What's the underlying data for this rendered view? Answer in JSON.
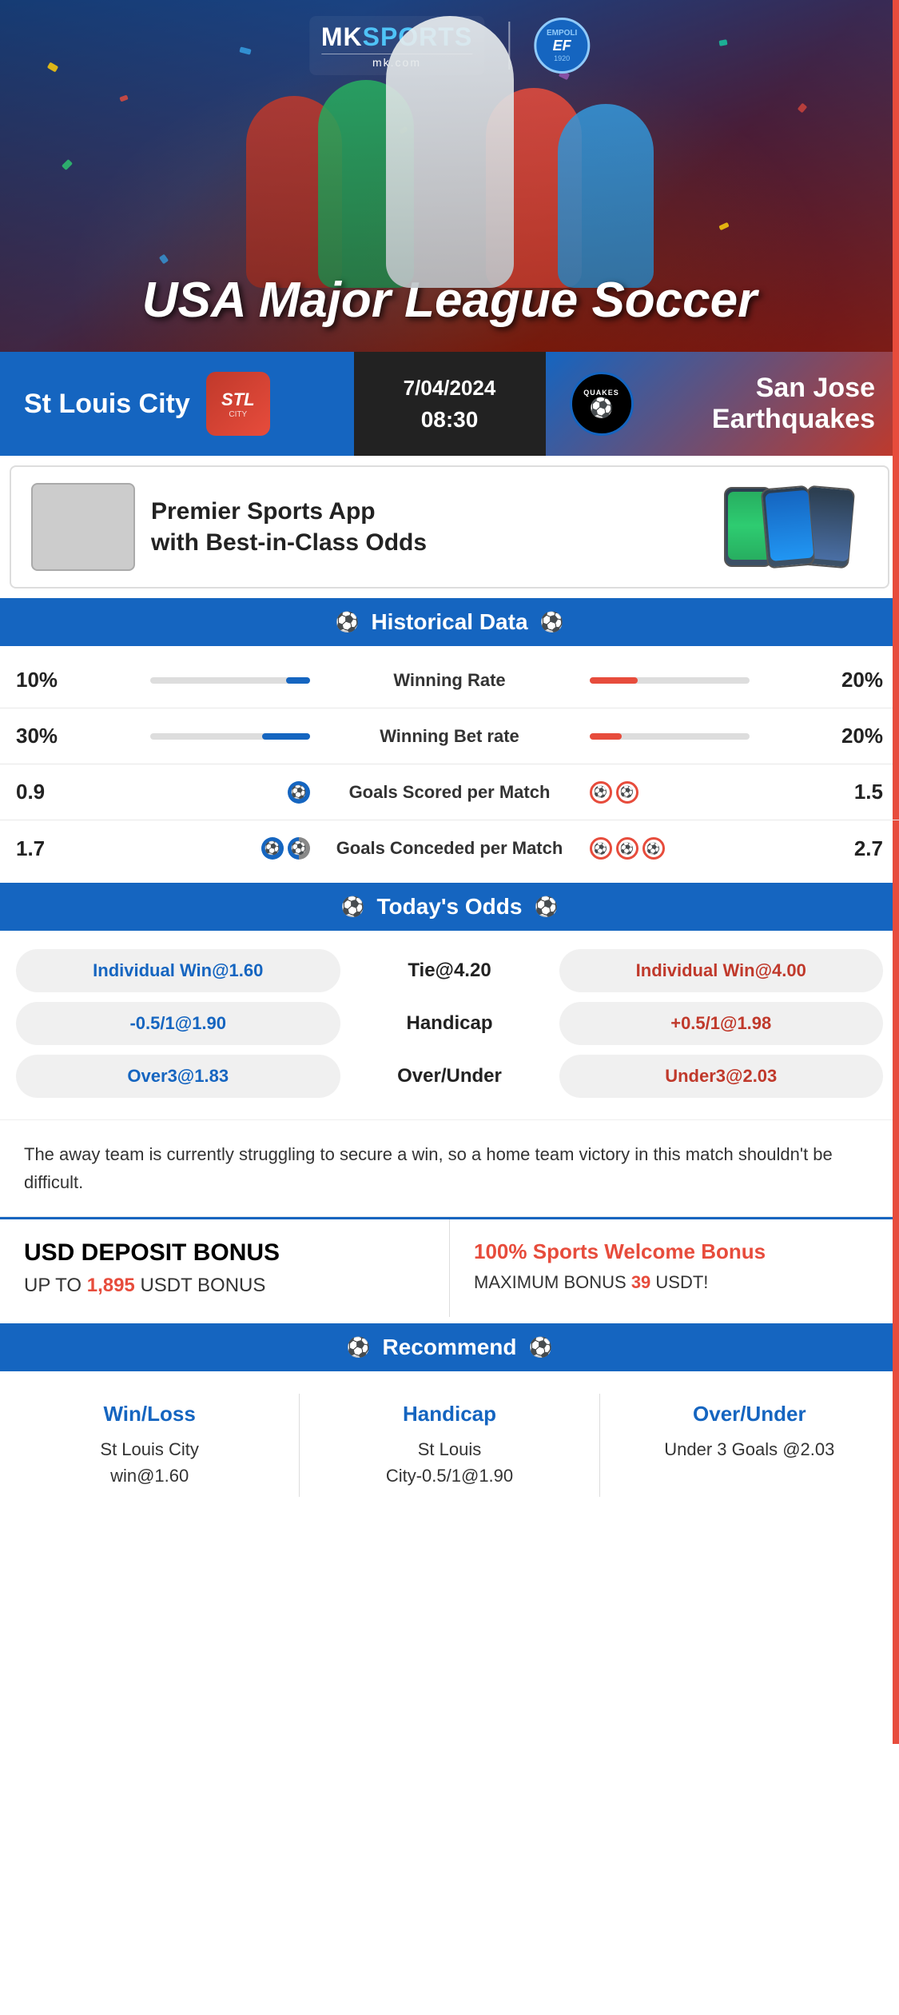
{
  "app": {
    "brand": {
      "name": "MKSPORTS",
      "domain": "mk.com",
      "partner": "EMPOLI F.C.",
      "partner_year": "1920"
    }
  },
  "hero": {
    "title": "USA Major League Soccer"
  },
  "match": {
    "date": "7/04/2024",
    "time": "08:30",
    "home_team": "St Louis City",
    "away_team": "San Jose Earthquakes",
    "away_team_short": "QUAKES"
  },
  "app_promo": {
    "text": "Premier Sports App\nwith Best-in-Class Odds"
  },
  "historical": {
    "section_title": "Historical Data",
    "rows": [
      {
        "label": "Winning Rate",
        "left_val": "10%",
        "right_val": "20%",
        "left_pct": 15,
        "right_pct": 30
      },
      {
        "label": "Winning Bet rate",
        "left_val": "30%",
        "right_val": "20%",
        "left_pct": 30,
        "right_pct": 20
      },
      {
        "label": "Goals Scored per Match",
        "left_val": "0.9",
        "right_val": "1.5",
        "left_icons": 1,
        "right_icons": 2
      },
      {
        "label": "Goals Conceded per Match",
        "left_val": "1.7",
        "right_val": "2.7",
        "left_icons": 2,
        "right_icons": 3
      }
    ]
  },
  "odds": {
    "section_title": "Today's Odds",
    "rows": [
      {
        "left": "Individual Win@1.60",
        "center": "Tie@4.20",
        "right": "Individual Win@4.00",
        "left_color": "blue",
        "right_color": "red"
      },
      {
        "left": "-0.5/1@1.90",
        "center": "Handicap",
        "right": "+0.5/1@1.98",
        "left_color": "blue",
        "right_color": "red"
      },
      {
        "left": "Over3@1.83",
        "center": "Over/Under",
        "right": "Under3@2.03",
        "left_color": "blue",
        "right_color": "red"
      }
    ]
  },
  "analysis": {
    "text": "The away team is currently struggling to secure a win, so a home team victory in this match shouldn't be difficult."
  },
  "bonus": {
    "left_title": "USD DEPOSIT BONUS",
    "left_sub": "UP TO",
    "left_amount": "1,895",
    "left_suffix": "USDT BONUS",
    "right_prefix": "100%",
    "right_title": "Sports Welcome Bonus",
    "right_sub": "MAXIMUM BONUS",
    "right_amount": "39",
    "right_suffix": "USDT!"
  },
  "recommend": {
    "section_title": "Recommend",
    "cards": [
      {
        "title": "Win/Loss",
        "body": "St Louis City\nwin@1.60"
      },
      {
        "title": "Handicap",
        "body": "St Louis\nCity-0.5/1@1.90"
      },
      {
        "title": "Over/Under",
        "body": "Under 3 Goals @2.03"
      }
    ]
  }
}
